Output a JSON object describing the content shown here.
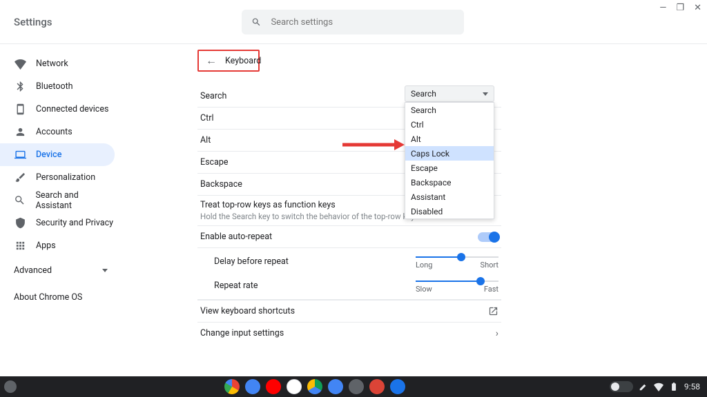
{
  "window": {
    "app_title": "Settings",
    "search_placeholder": "Search settings"
  },
  "sidebar": {
    "items": [
      {
        "label": "Network",
        "icon": "wifi-icon"
      },
      {
        "label": "Bluetooth",
        "icon": "bluetooth-icon"
      },
      {
        "label": "Connected devices",
        "icon": "device-icon"
      },
      {
        "label": "Accounts",
        "icon": "person-icon"
      },
      {
        "label": "Device",
        "icon": "laptop-icon"
      },
      {
        "label": "Personalization",
        "icon": "brush-icon"
      },
      {
        "label": "Search and Assistant",
        "icon": "search-icon"
      },
      {
        "label": "Security and Privacy",
        "icon": "shield-icon"
      },
      {
        "label": "Apps",
        "icon": "apps-icon"
      }
    ],
    "advanced_label": "Advanced",
    "about_label": "About Chrome OS"
  },
  "subpage": {
    "title": "Keyboard",
    "rows": [
      {
        "label": "Search"
      },
      {
        "label": "Ctrl"
      },
      {
        "label": "Alt"
      },
      {
        "label": "Escape"
      },
      {
        "label": "Backspace"
      }
    ],
    "function_keys": {
      "title": "Treat top-row keys as function keys",
      "subtitle": "Hold the Search key to switch the behavior of the top-row keys"
    },
    "auto_repeat_label": "Enable auto-repeat",
    "delay": {
      "label": "Delay before repeat",
      "min_label": "Long",
      "max_label": "Short",
      "pct": 55
    },
    "rate": {
      "label": "Repeat rate",
      "min_label": "Slow",
      "max_label": "Fast",
      "pct": 78
    },
    "view_shortcuts": "View keyboard shortcuts",
    "change_input": "Change input settings"
  },
  "dropdown": {
    "selected": "Search",
    "options": [
      "Search",
      "Ctrl",
      "Alt",
      "Caps Lock",
      "Escape",
      "Backspace",
      "Assistant",
      "Disabled"
    ],
    "highlighted_index": 3
  },
  "shelf": {
    "app_colors": [
      "#ffffff",
      "#4285f4",
      "#ff0000",
      "#ffffff",
      "#0f9d58",
      "#4285f4",
      "#5f6368",
      "#db4437",
      "#1a73e8"
    ],
    "clock": "9:58"
  }
}
